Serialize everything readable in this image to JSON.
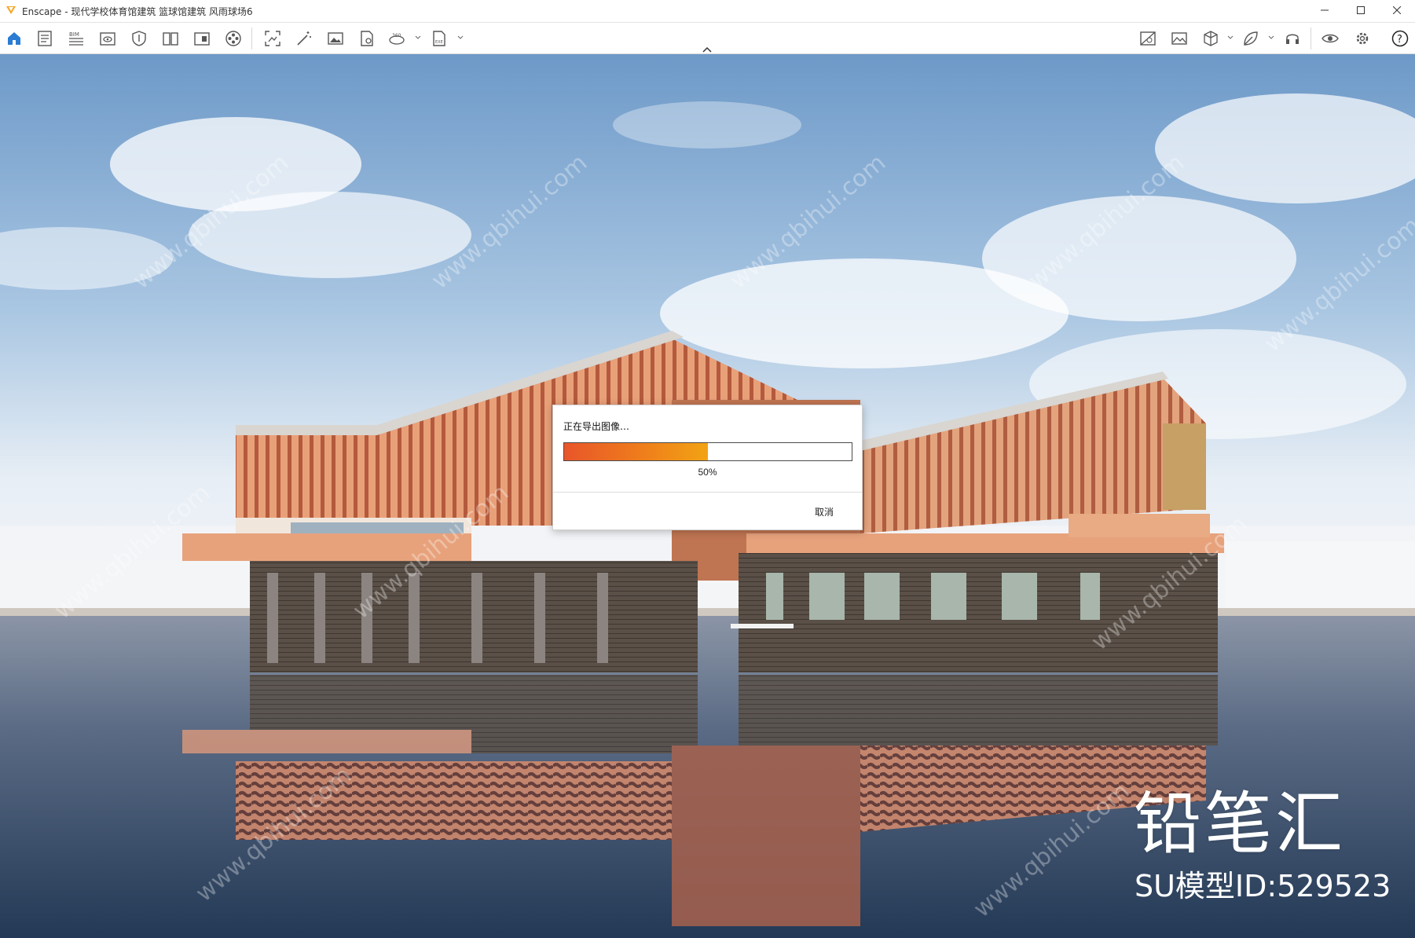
{
  "window": {
    "title": "Enscape - 现代学校体育馆建筑 篮球馆建筑 风雨球场6",
    "minimize_icon": "minimize-icon",
    "maximize_icon": "maximize-icon",
    "close_icon": "close-icon"
  },
  "toolbar": {
    "left_tools": [
      {
        "name": "home-icon",
        "active": true
      },
      {
        "name": "document-icon"
      },
      {
        "name": "bim-icon"
      },
      {
        "name": "eye-panel-icon"
      },
      {
        "name": "shield-icon"
      },
      {
        "name": "views-icon"
      },
      {
        "name": "panorama-icon"
      },
      {
        "name": "film-reel-icon"
      },
      {
        "name": "screenshot-icon"
      },
      {
        "name": "magic-wand-icon"
      },
      {
        "name": "image-icon"
      },
      {
        "name": "export-settings-icon"
      },
      {
        "name": "360-panorama-icon"
      },
      {
        "name": "exe-export-icon"
      }
    ],
    "right_tools": [
      {
        "name": "render-settings-icon"
      },
      {
        "name": "atmosphere-icon"
      },
      {
        "name": "cube-icon"
      },
      {
        "name": "leaf-icon"
      },
      {
        "name": "headset-icon"
      },
      {
        "name": "visibility-icon"
      },
      {
        "name": "settings-icon"
      },
      {
        "name": "help-icon"
      }
    ],
    "accent_color": "#2b7cd3"
  },
  "dialog": {
    "title": "正在导出图像…",
    "progress_percent": 50,
    "progress_text": "50%",
    "cancel_label": "取消"
  },
  "watermark": {
    "brand": "铅笔汇",
    "model_id": "SU模型ID:529523",
    "site": "www.qbihui.com"
  }
}
